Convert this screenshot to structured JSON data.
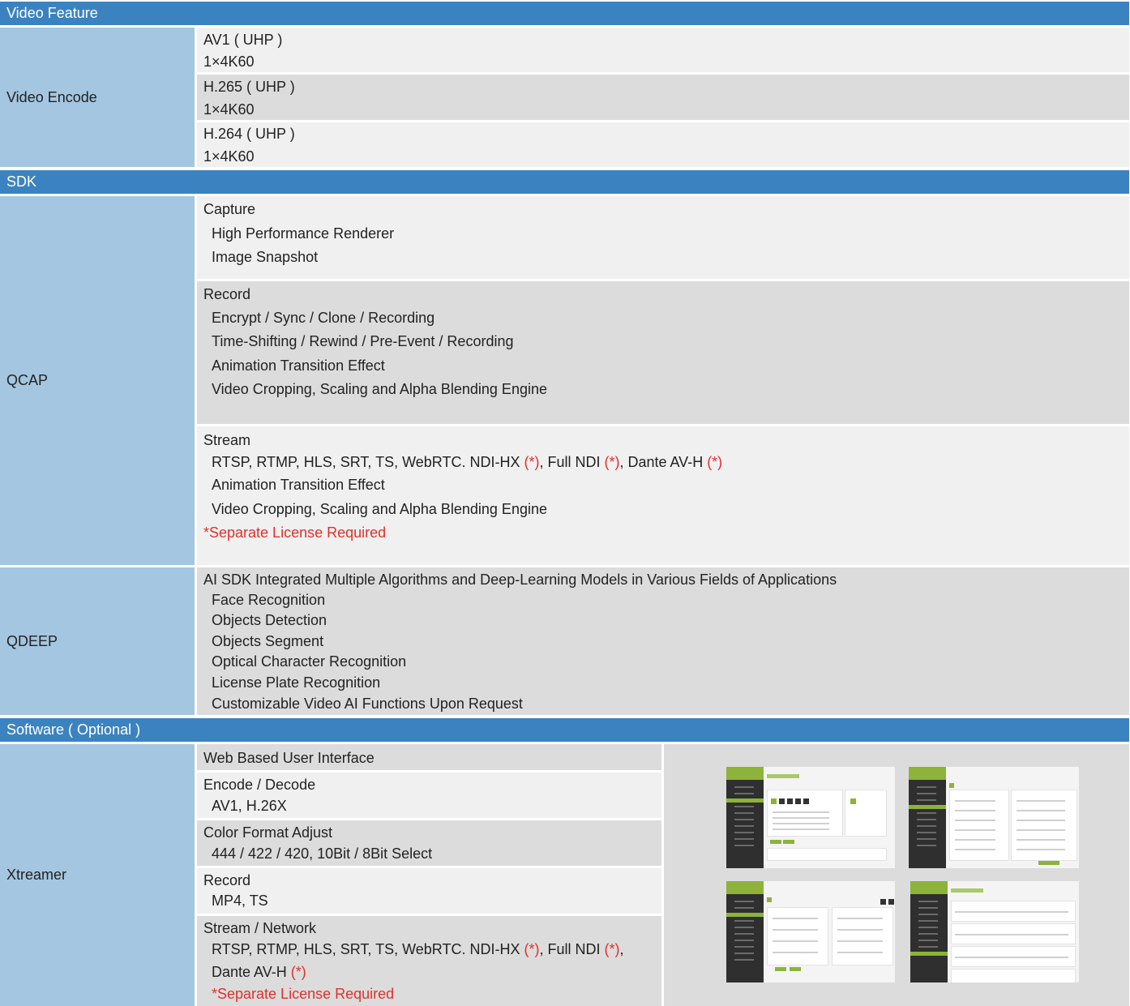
{
  "sections": {
    "video_feature": "Video Feature",
    "sdk": "SDK",
    "software": "Software ( Optional )"
  },
  "video_encode": {
    "label": "Video Encode",
    "codecs": [
      {
        "name": "AV1 ( UHP )",
        "spec": "1×4K60"
      },
      {
        "name": "H.265 ( UHP )",
        "spec": "1×4K60"
      },
      {
        "name": "H.264 ( UHP )",
        "spec": "1×4K60"
      }
    ]
  },
  "qcap": {
    "label": "QCAP",
    "capture": {
      "title": "Capture",
      "items": [
        "High Performance Renderer",
        "Image Snapshot"
      ]
    },
    "record": {
      "title": "Record",
      "items": [
        "Encrypt / Sync / Clone / Recording",
        "Time-Shifting / Rewind / Pre-Event / Recording",
        "Animation Transition Effect",
        "Video Cropping, Scaling and Alpha Blending Engine"
      ]
    },
    "stream": {
      "title": "Stream",
      "protocols_a": "RTSP, RTMP, HLS, SRT, TS, WebRTC. NDI-HX ",
      "mark": "(*)",
      "protocols_b": ", Full NDI ",
      "protocols_c": ", Dante AV-H ",
      "items": [
        "Animation Transition Effect",
        "Video Cropping, Scaling and Alpha Blending Engine"
      ],
      "license_note": "*Separate License Required"
    }
  },
  "qdeep": {
    "label": "QDEEP",
    "title": "AI SDK Integrated Multiple Algorithms and Deep-Learning Models in Various Fields of Applications",
    "items": [
      "Face Recognition",
      "Objects Detection",
      "Objects Segment",
      "Optical Character Recognition",
      "License Plate Recognition",
      "Customizable Video AI Functions Upon Request"
    ]
  },
  "xtreamer": {
    "label": "Xtreamer",
    "web_ui": "Web Based User Interface",
    "encode": {
      "title": "Encode / Decode",
      "value": "AV1, H.26X"
    },
    "color": {
      "title": "Color Format Adjust",
      "value": "444 / 422 / 420, 10Bit / 8Bit Select"
    },
    "record": {
      "title": "Record",
      "value": "MP4, TS"
    },
    "stream": {
      "title": "Stream / Network",
      "line1a": "RTSP, RTMP, HLS, SRT, TS, WebRTC. NDI-HX ",
      "mark": "(*)",
      "line1b": ", Full NDI ",
      "line1c": ",",
      "line2": "Dante AV-H ",
      "license_note": "*Separate License Required"
    }
  }
}
